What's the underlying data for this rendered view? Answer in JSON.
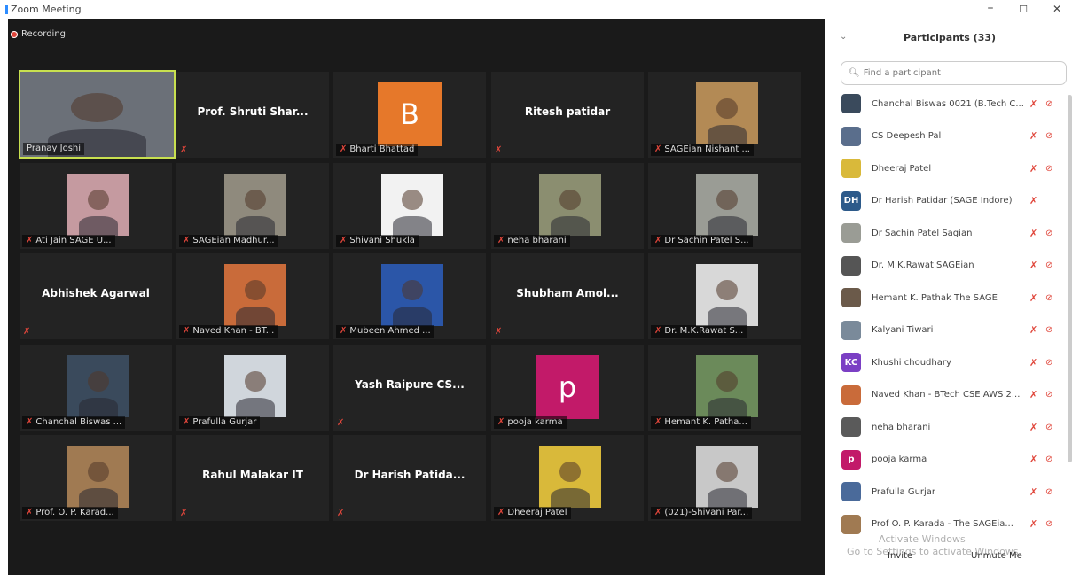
{
  "window": {
    "title": "Zoom Meeting",
    "min": "–",
    "max": "☐",
    "close": "✕"
  },
  "recording": "Recording",
  "tiles": [
    {
      "caption": "Pranay Joshi",
      "type": "video",
      "bg": "#6b7078"
    },
    {
      "name": "Prof. Shruti Shar...",
      "caption": "",
      "type": "name"
    },
    {
      "caption": "Bharti Bhattad",
      "type": "letter",
      "letter": "B"
    },
    {
      "name": "Ritesh patidar",
      "caption": "",
      "type": "name"
    },
    {
      "caption": "SAGEian Nishant ...",
      "type": "video",
      "bg": "#b38a55"
    },
    {
      "caption": "Ati Jain SAGE U...",
      "type": "video",
      "bg": "#c59aa0"
    },
    {
      "caption": "SAGEian Madhur...",
      "type": "video",
      "bg": "#8f8a7d"
    },
    {
      "caption": "Shivani Shukla",
      "type": "video",
      "bg": "#f2f2f2"
    },
    {
      "caption": "neha bharani",
      "type": "video",
      "bg": "#8b8e70"
    },
    {
      "caption": "Dr Sachin Patel S...",
      "type": "video",
      "bg": "#9a9c95"
    },
    {
      "name": "Abhishek Agarwal",
      "caption": "",
      "type": "name"
    },
    {
      "caption": "Naved Khan - BT...",
      "type": "video",
      "bg": "#c96b3a"
    },
    {
      "caption": "Mubeen Ahmed ...",
      "type": "video",
      "bg": "#2b56a8"
    },
    {
      "name": "Shubham Amol...",
      "caption": "",
      "type": "name"
    },
    {
      "caption": "Dr. M.K.Rawat S...",
      "type": "video",
      "bg": "#d8d8d8"
    },
    {
      "caption": "Chanchal Biswas ...",
      "type": "video",
      "bg": "#3a4a5c"
    },
    {
      "caption": "Prafulla Gurjar",
      "type": "video",
      "bg": "#d0d6dc"
    },
    {
      "name": "Yash Raipure CS...",
      "caption": "",
      "type": "name"
    },
    {
      "caption": "pooja karma",
      "type": "letter",
      "letter": "p"
    },
    {
      "caption": "Hemant K. Patha...",
      "type": "video",
      "bg": "#6b8a5a"
    },
    {
      "caption": "Prof. O. P. Karad...",
      "type": "video",
      "bg": "#a07a52"
    },
    {
      "name": "Rahul Malakar IT",
      "caption": "",
      "type": "name"
    },
    {
      "name": "Dr Harish Patida...",
      "caption": "",
      "type": "name"
    },
    {
      "caption": "Dheeraj Patel",
      "type": "video",
      "bg": "#d9b93a"
    },
    {
      "caption": "(021)-Shivani Par...",
      "type": "video",
      "bg": "#c8c8c8"
    }
  ],
  "participants": {
    "title": "Participants (33)",
    "search_placeholder": "Find a participant",
    "list": [
      {
        "name": "Chanchal Biswas 0021 (B.Tech C...",
        "avatar_color": "#3a4a5c",
        "initials": ""
      },
      {
        "name": "CS Deepesh Pal",
        "avatar_color": "#5a6e8c",
        "initials": ""
      },
      {
        "name": "Dheeraj Patel",
        "avatar_color": "#d9b93a",
        "initials": ""
      },
      {
        "name": "Dr Harish Patidar (SAGE Indore)",
        "avatar_color": "#2d5a8a",
        "initials": "DH"
      },
      {
        "name": "Dr Sachin Patel Sagian",
        "avatar_color": "#9a9c95",
        "initials": ""
      },
      {
        "name": "Dr. M.K.Rawat SAGEian",
        "avatar_color": "#555555",
        "initials": ""
      },
      {
        "name": "Hemant K. Pathak The SAGE",
        "avatar_color": "#6b5a4a",
        "initials": ""
      },
      {
        "name": "Kalyani Tiwari",
        "avatar_color": "#7a8a9a",
        "initials": ""
      },
      {
        "name": "Khushi choudhary",
        "avatar_color": "#7b3fc4",
        "initials": "KC"
      },
      {
        "name": "Naved Khan - BTech CSE AWS 2...",
        "avatar_color": "#c96b3a",
        "initials": ""
      },
      {
        "name": "neha bharani",
        "avatar_color": "#5a5a5a",
        "initials": ""
      },
      {
        "name": "pooja karma",
        "avatar_color": "#c21a69",
        "initials": "p"
      },
      {
        "name": "Prafulla Gurjar",
        "avatar_color": "#4a6a9a",
        "initials": ""
      },
      {
        "name": "Prof O. P. Karada - The SAGEia...",
        "avatar_color": "#a07a52",
        "initials": ""
      }
    ],
    "watermark_line1": "Activate Windows",
    "watermark_line2": "Go to Settings to activate Windows.",
    "invite_label": "Invite",
    "unmute_label": "Unmute Me"
  },
  "icons": {
    "mic_muted": "mic-muted-icon",
    "cam_off": "camera-off-icon",
    "search": "search-icon"
  },
  "colors": {
    "accent_active": "#c8e04f",
    "muted_red": "#e0463b",
    "bg_dark": "#1a1a1a"
  }
}
